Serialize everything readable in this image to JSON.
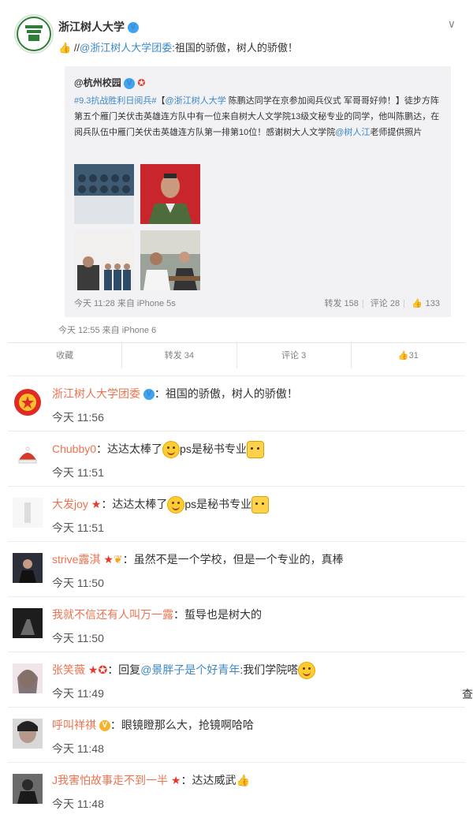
{
  "post": {
    "author": "浙江树人大学",
    "prefix": "//",
    "mention": "@浙江树人大学团委",
    "text": ":祖国的骄傲，树人的骄傲！",
    "meta": "今天 12:55 来自 iPhone 6"
  },
  "repost": {
    "author": "@杭州校园",
    "hashtag": "#9.3抗战胜利日阅兵#",
    "bracket_open": "【",
    "mention": "@浙江树人大学",
    "title_rest": " 陈鹏达同学在京参加阅兵仪式 军哥哥好帅！】",
    "body": "徒步方阵第五个雁门关伏击英雄连方队中有一位来自树大人文学院13级文秘专业的同学，他叫陈鹏达，在阅兵队伍中雁门关伏击英雄连方队第一排第10位！感谢树大人文学院",
    "mention2": "@树人江",
    "body_end": "老师提供照片",
    "meta": "今天 11:28 来自 iPhone 5s",
    "repost_label": "转发 158",
    "comment_label": "评论 28",
    "like_label": "133"
  },
  "actions": {
    "favorite": "收藏",
    "repost": "转发 34",
    "comment": "评论 3",
    "like": "31"
  },
  "comments": [
    {
      "name": "浙江树人大学团委",
      "text": "：祖国的骄傲，树人的骄傲！",
      "time": "今天 11:56"
    },
    {
      "name": "Chubby0",
      "text": "：达达太棒了",
      "text2": "ps是秘书专业",
      "time": "今天 11:51"
    },
    {
      "name": "大发joy",
      "text": "：达达太棒了",
      "text2": "ps是秘书专业",
      "time": "今天 11:51"
    },
    {
      "name": "strive露淇",
      "text": "：虽然不是一个学校，但是一个专业的，真棒",
      "time": "今天 11:50"
    },
    {
      "name": "我就不信还有人叫万一露",
      "text": "：蜇导也是树大的",
      "time": "今天 11:50"
    },
    {
      "name": "张笑薇",
      "text": "：回复",
      "mention": "@景胖子是个好青年",
      "text2": ":我们学院嗒",
      "time": "今天 11:49"
    },
    {
      "name": "呼叫祥祺",
      "text": "：眼镜瞪那么大，抢镜啊哈哈",
      "time": "今天 11:48"
    },
    {
      "name": "J我害怕故事走不到一半",
      "text": "：达达威武",
      "time": "今天 11:48"
    }
  ],
  "edge_char": "查",
  "colors": {
    "link": "#eb7350",
    "mention": "#3b88c7",
    "meta": "#808080"
  }
}
